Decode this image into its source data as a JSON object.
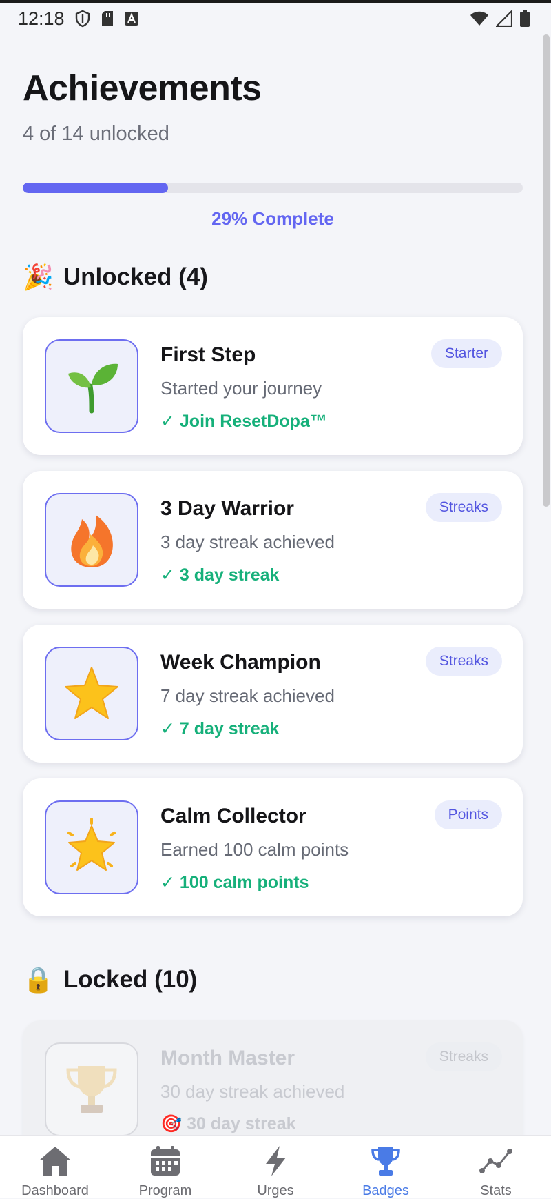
{
  "status_bar": {
    "time": "12:18",
    "left_icons": [
      "shield-icon",
      "sd-card-icon",
      "keyboard-a-icon"
    ],
    "right_icons": [
      "wifi-icon",
      "cell-signal-icon",
      "battery-icon"
    ]
  },
  "header": {
    "title": "Achievements",
    "subtitle": "4 of 14 unlocked",
    "progress_fraction": 0.29,
    "progress_label": "29% Complete",
    "accent_color": "#6366f1"
  },
  "unlocked_section": {
    "emoji": "🎉",
    "title": "Unlocked (4)",
    "items": [
      {
        "emoji": "🌱",
        "title": "First Step",
        "desc": "Started your journey",
        "req": "✓ Join ResetDopa™",
        "tag": "Starter"
      },
      {
        "emoji": "🔥",
        "title": "3 Day Warrior",
        "desc": "3 day streak achieved",
        "req": "✓ 3 day streak",
        "tag": "Streaks"
      },
      {
        "emoji": "⭐",
        "title": "Week Champion",
        "desc": "7 day streak achieved",
        "req": "✓ 7 day streak",
        "tag": "Streaks"
      },
      {
        "emoji": "🌟",
        "title": "Calm Collector",
        "desc": "Earned 100 calm points",
        "req": "✓ 100 calm points",
        "tag": "Points"
      }
    ]
  },
  "locked_section": {
    "emoji": "🔒",
    "title": "Locked (10)",
    "items": [
      {
        "emoji": "🏆",
        "title": "Month Master",
        "desc": "30 day streak achieved",
        "req": "🎯 30 day streak",
        "tag": "Streaks"
      }
    ]
  },
  "bottom_nav": {
    "items": [
      {
        "label": "Dashboard",
        "icon": "home-icon"
      },
      {
        "label": "Program",
        "icon": "calendar-icon"
      },
      {
        "label": "Urges",
        "icon": "lightning-icon"
      },
      {
        "label": "Badges",
        "icon": "trophy-icon",
        "active": true
      },
      {
        "label": "Stats",
        "icon": "trend-line-icon"
      }
    ],
    "active_color": "#4a7be6"
  }
}
